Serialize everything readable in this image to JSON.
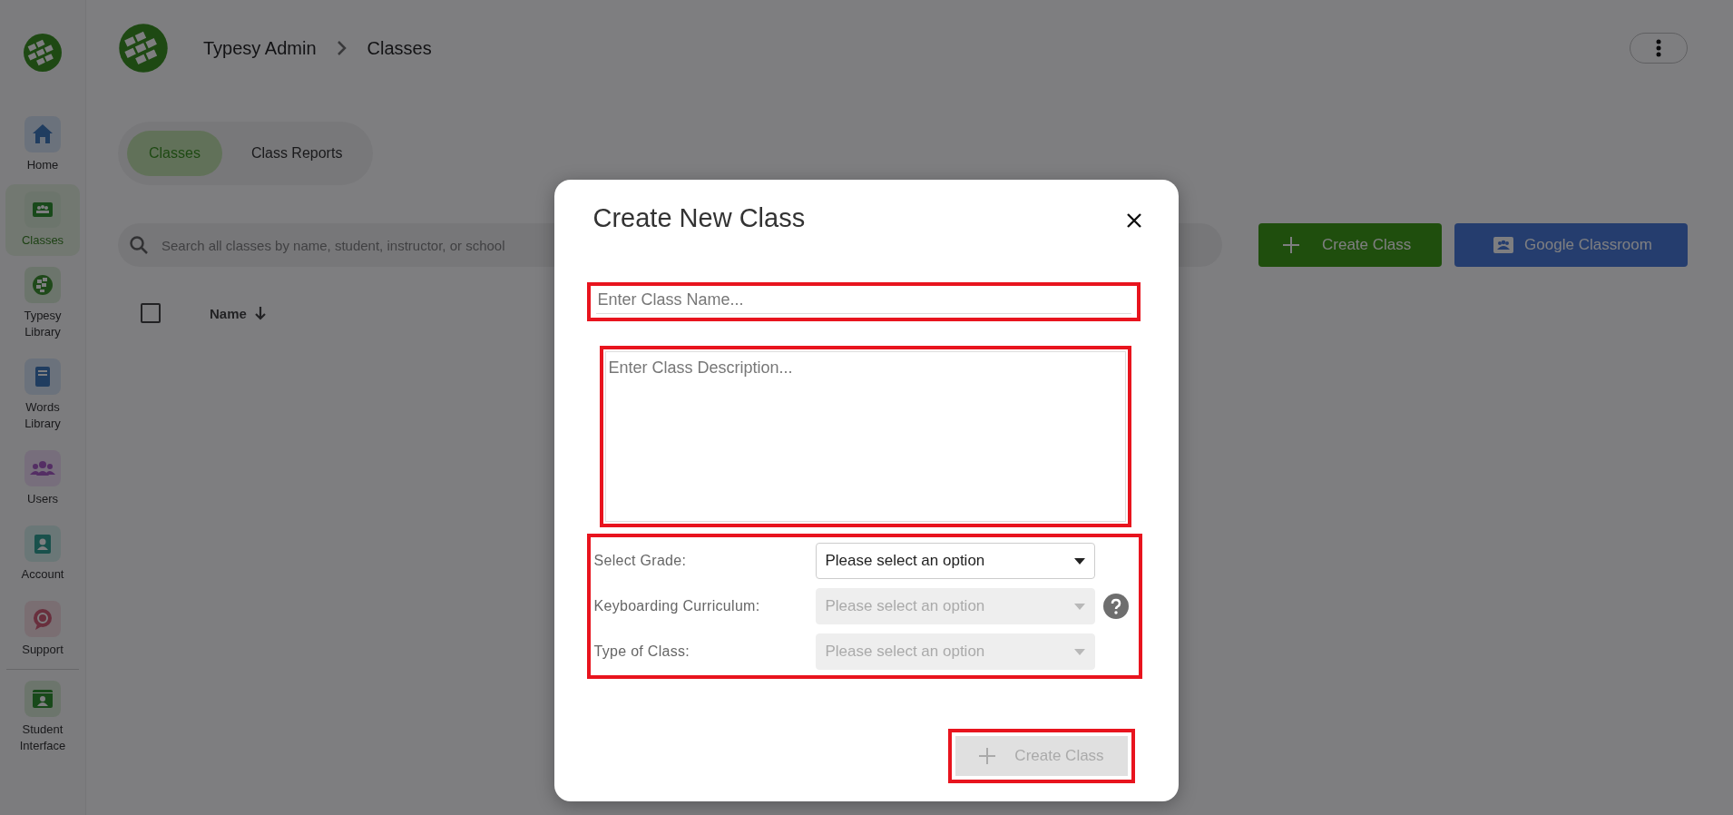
{
  "sidebar": {
    "items": [
      {
        "label": "Home",
        "selected": false
      },
      {
        "label": "Classes",
        "selected": true
      },
      {
        "label": "Typesy Library",
        "selected": false
      },
      {
        "label": "Words Library",
        "selected": false
      },
      {
        "label": "Users",
        "selected": false
      },
      {
        "label": "Account",
        "selected": false
      },
      {
        "label": "Support",
        "selected": false
      }
    ],
    "footer_items": [
      {
        "label": "Student Interface",
        "selected": false
      }
    ]
  },
  "header": {
    "breadcrumb": [
      "Typesy Admin",
      "Classes"
    ]
  },
  "tabs": [
    {
      "label": "Classes",
      "selected": true
    },
    {
      "label": "Class Reports",
      "selected": false
    }
  ],
  "search": {
    "placeholder": "Search all classes by name, student, instructor, or school"
  },
  "actions": [
    {
      "label": "Create Class",
      "kind": "create"
    },
    {
      "label": "Google Classroom",
      "kind": "google"
    }
  ],
  "table": {
    "select_all": {
      "checked": false
    },
    "columns": [
      {
        "label": "Name",
        "sorted": true
      }
    ]
  },
  "modal": {
    "title": "Create New Class",
    "name_field": {
      "placeholder": "Enter Class Name...",
      "highlighted": true
    },
    "description_field": {
      "placeholder": "Enter Class Description...",
      "highlighted": true
    },
    "selects": {
      "highlighted": true,
      "rows": [
        {
          "label": "Select Grade:",
          "placeholder": "Please select an option",
          "disabled": false,
          "help": false
        },
        {
          "label": "Keyboarding Curriculum:",
          "placeholder": "Please select an option",
          "disabled": true,
          "help": true
        },
        {
          "label": "Type of Class:",
          "placeholder": "Please select an option",
          "disabled": true,
          "help": false
        }
      ]
    },
    "submit": {
      "label": "Create Class",
      "disabled": true,
      "highlighted": true
    }
  }
}
